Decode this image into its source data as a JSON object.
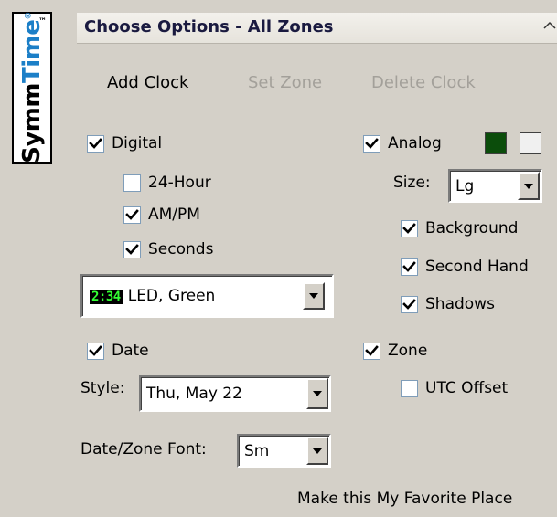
{
  "logo": {
    "symm": "Symm",
    "time": "Time",
    "tm": "™",
    "reg": "®"
  },
  "header": {
    "title": "Choose Options - All Zones"
  },
  "actions": {
    "add_clock": "Add Clock",
    "set_zone": "Set Zone",
    "delete_clock": "Delete Clock"
  },
  "digital": {
    "label": "Digital",
    "checked": true,
    "hour24": {
      "label": "24-Hour",
      "checked": false
    },
    "ampm": {
      "label": "AM/PM",
      "checked": true
    },
    "seconds": {
      "label": "Seconds",
      "checked": true
    },
    "style": {
      "preview": "2:34",
      "value": "LED, Green"
    }
  },
  "analog": {
    "label": "Analog",
    "checked": true,
    "colors": {
      "face": "#0b4d0b",
      "background": "#f0f0f0"
    },
    "size_label": "Size:",
    "size_value": "Lg",
    "background": {
      "label": "Background",
      "checked": true
    },
    "second_hand": {
      "label": "Second Hand",
      "checked": true
    },
    "shadows": {
      "label": "Shadows",
      "checked": true
    }
  },
  "date": {
    "label": "Date",
    "checked": true,
    "style_label": "Style:",
    "style_value": "Thu, May 22"
  },
  "zone": {
    "label": "Zone",
    "checked": true,
    "utc_offset": {
      "label": "UTC Offset",
      "checked": false
    }
  },
  "font": {
    "label": "Date/Zone Font:",
    "value": "Sm"
  },
  "footer": {
    "favorite": "Make this My Favorite Place"
  }
}
